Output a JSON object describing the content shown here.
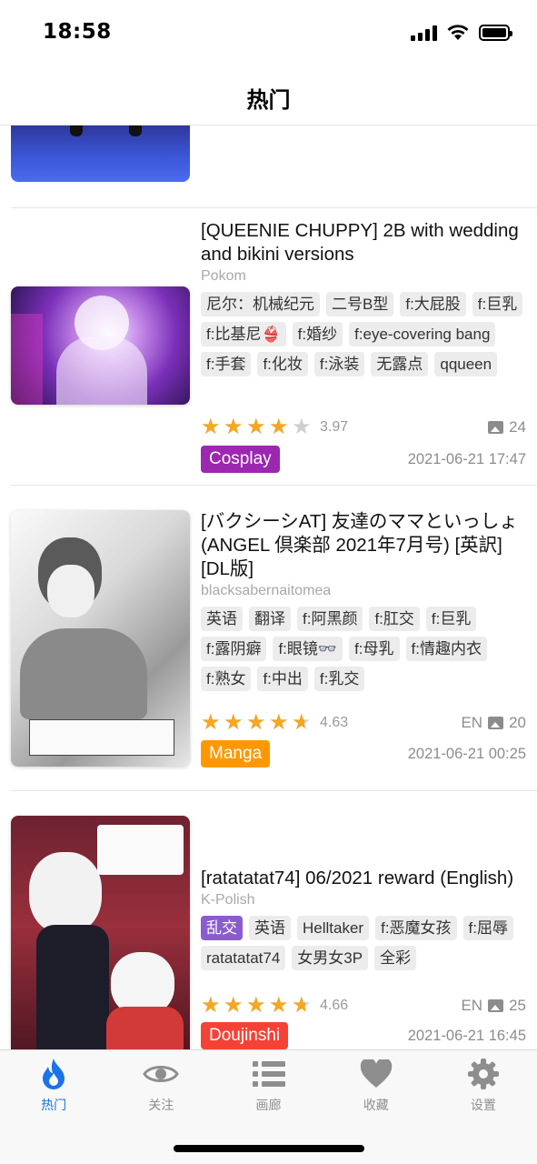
{
  "status_bar": {
    "time": "18:58"
  },
  "header": {
    "title": "热门"
  },
  "items": [
    {
      "title": "[QUEENIE CHUPPY] 2B with wedding and bikini versions",
      "uploader": "Pokom",
      "tags": [
        "尼尔：机械纪元",
        "二号B型",
        "f:大屁股",
        "f:巨乳",
        "f:比基尼👙",
        "f:婚纱",
        "f:eye-covering bang",
        "f:手套",
        "f:化妆",
        "f:泳装",
        "无露点",
        "qqueen"
      ],
      "rating": "3.97",
      "rating_value": 3.97,
      "language": "",
      "pages": "24",
      "category": "Cosplay",
      "category_color": "#9c27b0",
      "date": "2021-06-21 17:47"
    },
    {
      "title": "[バクシーシAT] 友達のママといっしょ (ANGEL 倶楽部 2021年7月号) [英訳] [DL版]",
      "uploader": "blacksabernaitomea",
      "tags": [
        "英语",
        "翻译",
        "f:阿黑颜",
        "f:肛交",
        "f:巨乳",
        "f:露阴癖",
        "f:眼镜👓",
        "f:母乳",
        "f:情趣内衣",
        "f:熟女",
        "f:中出",
        "f:乳交"
      ],
      "rating": "4.63",
      "rating_value": 4.63,
      "language": "EN",
      "pages": "20",
      "category": "Manga",
      "category_color": "#ff9800",
      "date": "2021-06-21 00:25"
    },
    {
      "title": "[ratatatat74] 06/2021 reward (English)",
      "uploader": "K-Polish",
      "tags": [
        "乱交",
        "英语",
        "Helltaker",
        "f:恶魔女孩",
        "f:屈辱",
        "ratatatat74",
        "女男女3P",
        "全彩"
      ],
      "highlight_tag_color": "#8a5ccf",
      "rating": "4.66",
      "rating_value": 4.66,
      "language": "EN",
      "pages": "25",
      "category": "Doujinshi",
      "category_color": "#f44336",
      "date": "2021-06-21 16:45"
    }
  ],
  "tab_bar": {
    "tabs": [
      {
        "label": "热门",
        "icon": "flame-icon",
        "active": true
      },
      {
        "label": "关注",
        "icon": "eye-icon",
        "active": false
      },
      {
        "label": "画廊",
        "icon": "list-icon",
        "active": false
      },
      {
        "label": "收藏",
        "icon": "heart-icon",
        "active": false
      },
      {
        "label": "设置",
        "icon": "gear-icon",
        "active": false
      }
    ],
    "active_color": "#1a73e8",
    "inactive_color": "#8e8e8e"
  }
}
